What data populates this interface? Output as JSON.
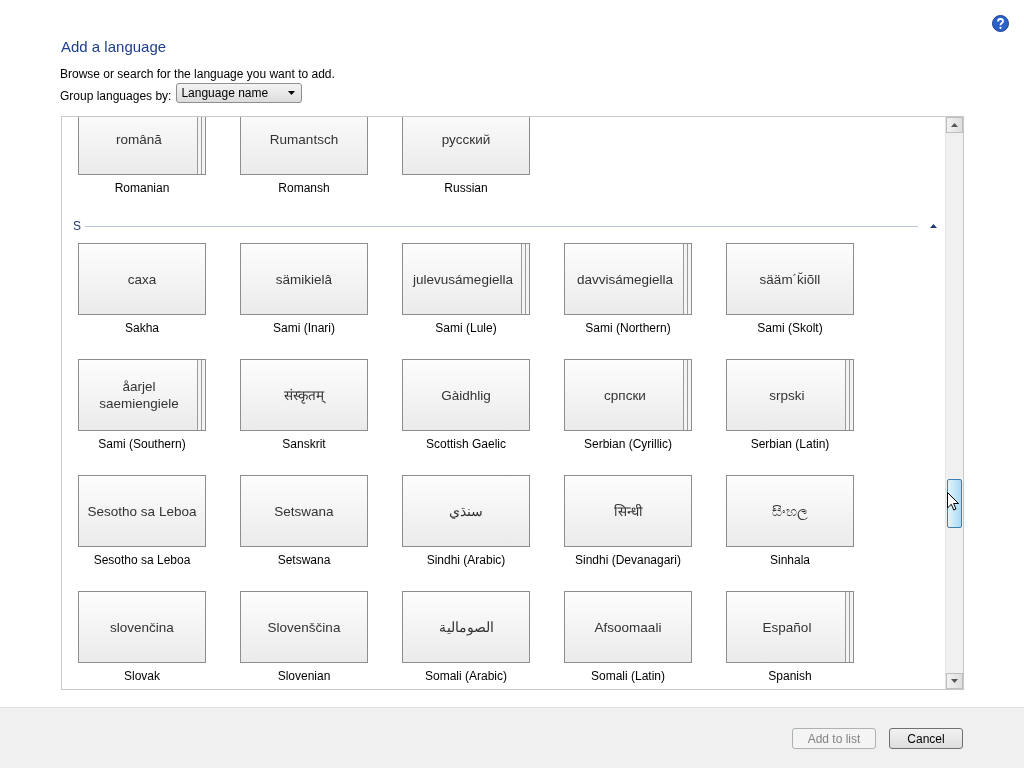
{
  "title": "Add a language",
  "instruction": "Browse or search for the language you want to add.",
  "group_by": {
    "label": "Group languages by:",
    "value": "Language name"
  },
  "groups": [
    {
      "items": [
        {
          "native": "română",
          "name": "Romanian",
          "stacked": true
        },
        {
          "native": "Rumantsch",
          "name": "Romansh",
          "stacked": false
        },
        {
          "native": "русский",
          "name": "Russian",
          "stacked": false
        }
      ]
    },
    {
      "letter": "S",
      "expanded": true,
      "items": [
        {
          "native": "caxa",
          "name": "Sakha",
          "stacked": false
        },
        {
          "native": "sämikielâ",
          "name": "Sami (Inari)",
          "stacked": false
        },
        {
          "native": "julevusámegiella",
          "name": "Sami (Lule)",
          "stacked": true
        },
        {
          "native": "davvisámegiella",
          "name": "Sami (Northern)",
          "stacked": true
        },
        {
          "native": "sääm´ǩiõll",
          "name": "Sami (Skolt)",
          "stacked": false
        },
        {
          "native": "åarjel saemiengiele",
          "name": "Sami (Southern)",
          "stacked": true
        },
        {
          "native": "संस्कृतम्",
          "name": "Sanskrit",
          "stacked": false
        },
        {
          "native": "Gàidhlig",
          "name": "Scottish Gaelic",
          "stacked": false
        },
        {
          "native": "српски",
          "name": "Serbian (Cyrillic)",
          "stacked": true
        },
        {
          "native": "srpski",
          "name": "Serbian (Latin)",
          "stacked": true
        },
        {
          "native": "Sesotho sa Leboa",
          "name": "Sesotho sa Leboa",
          "stacked": false
        },
        {
          "native": "Setswana",
          "name": "Setswana",
          "stacked": false
        },
        {
          "native": "سنڌي",
          "name": "Sindhi (Arabic)",
          "stacked": false
        },
        {
          "native": "सिन्धी",
          "name": "Sindhi (Devanagari)",
          "stacked": false
        },
        {
          "native": "සිංහල",
          "name": "Sinhala",
          "stacked": false
        },
        {
          "native": "slovenčina",
          "name": "Slovak",
          "stacked": false
        },
        {
          "native": "Slovenščina",
          "name": "Slovenian",
          "stacked": false
        },
        {
          "native": "الصومالية",
          "name": "Somali (Arabic)",
          "stacked": false
        },
        {
          "native": "Afsoomaali",
          "name": "Somali (Latin)",
          "stacked": false
        },
        {
          "native": "Español",
          "name": "Spanish",
          "stacked": true
        }
      ]
    }
  ],
  "buttons": [
    {
      "label": "Add to list",
      "disabled": true
    },
    {
      "label": "Cancel",
      "disabled": false
    }
  ]
}
